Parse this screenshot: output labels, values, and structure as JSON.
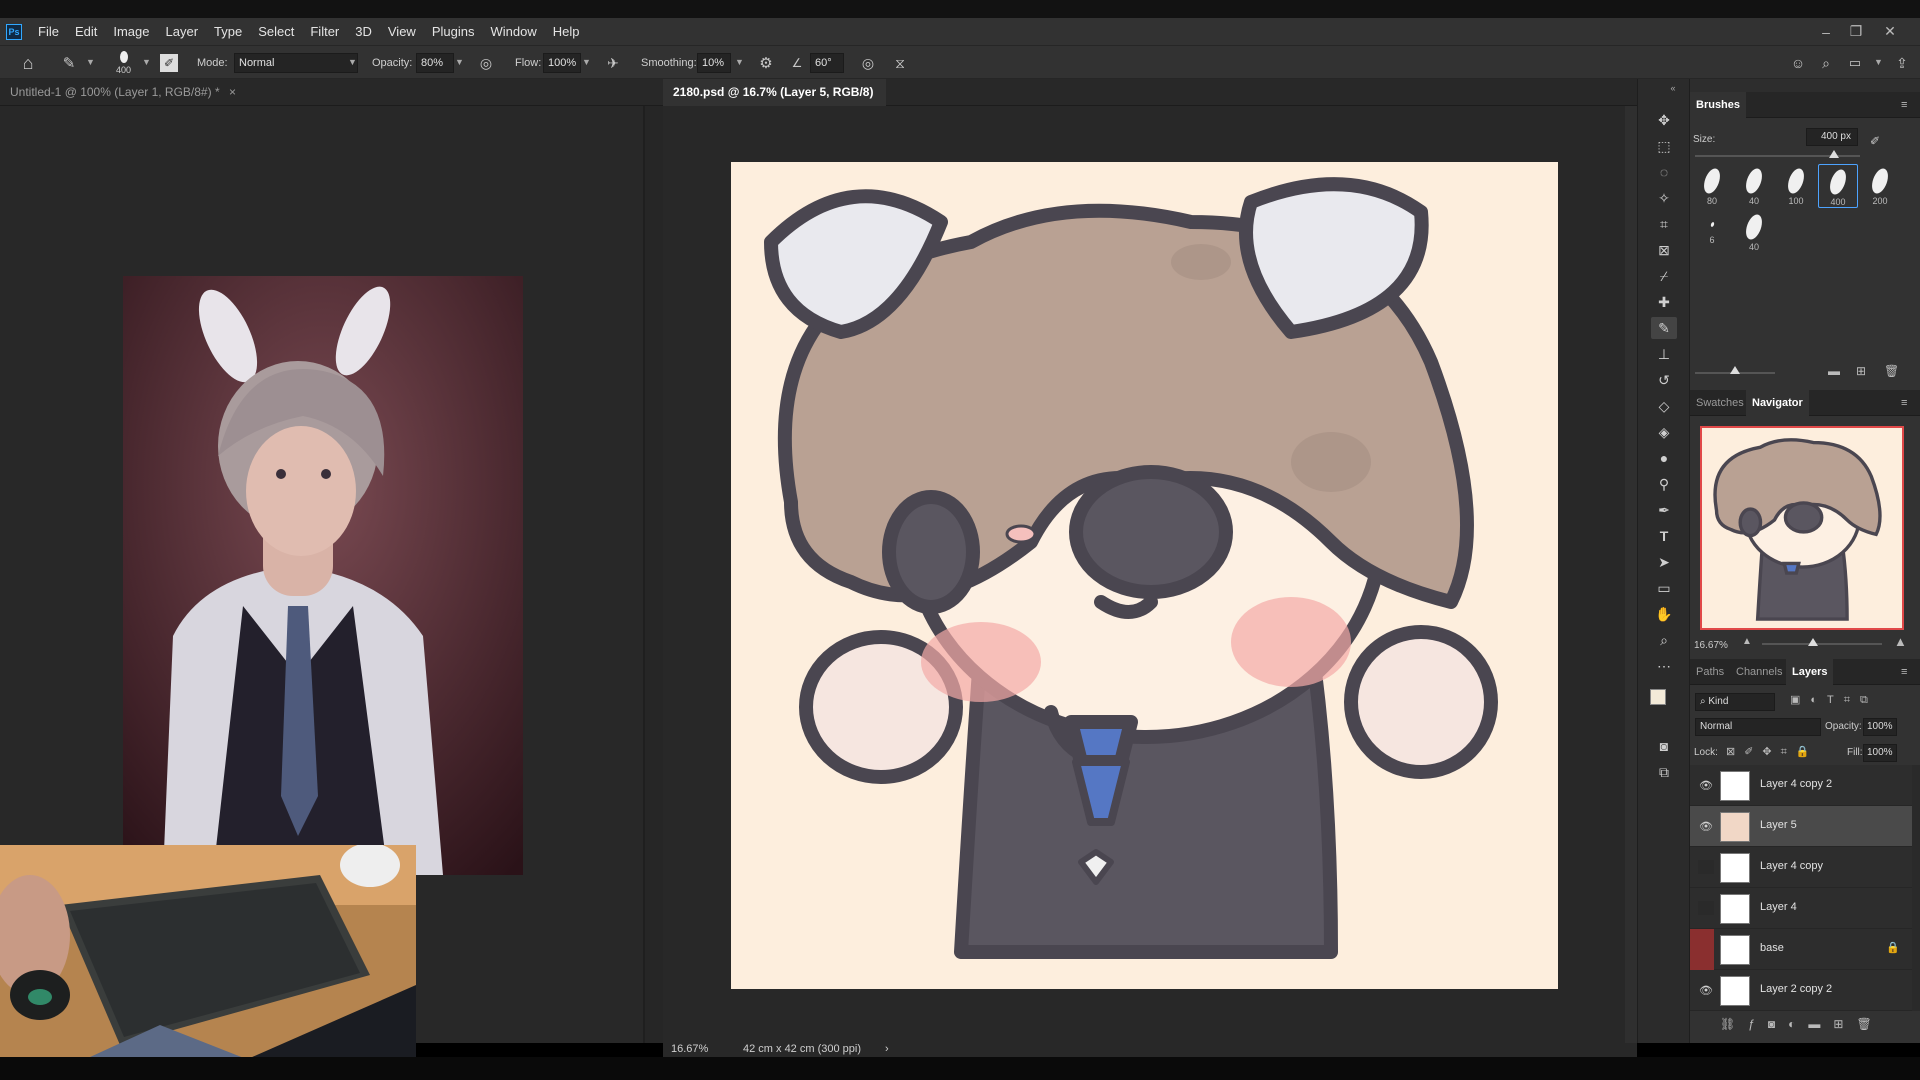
{
  "app": {
    "logo": "Ps"
  },
  "menu": [
    "File",
    "Edit",
    "Image",
    "Layer",
    "Type",
    "Select",
    "Filter",
    "3D",
    "View",
    "Plugins",
    "Window",
    "Help"
  ],
  "options": {
    "brush_size": "400",
    "mode_label": "Mode:",
    "mode_value": "Normal",
    "opacity_label": "Opacity:",
    "opacity_value": "80%",
    "flow_label": "Flow:",
    "flow_value": "100%",
    "smoothing_label": "Smoothing:",
    "smoothing_value": "10%",
    "angle_value": "60°"
  },
  "tabs": [
    {
      "label": "Untitled-1 @ 100% (Layer 1, RGB/8#) *",
      "close": "×"
    },
    {
      "label": "2180.psd @ 16.7% (Layer 5, RGB/8) *",
      "close": "×"
    }
  ],
  "status": {
    "zoom": "16.67%",
    "doc_size": "42 cm x 42 cm (300 ppi)",
    "arrow": "›"
  },
  "brushes": {
    "title": "Brushes",
    "size_label": "Size:",
    "size_value": "400 px",
    "tips": [
      "80",
      "40",
      "100",
      "400",
      "200",
      "6",
      "40"
    ]
  },
  "navigator": {
    "tabs": [
      "Swatches",
      "Navigator"
    ],
    "zoom": "16.67%"
  },
  "layers_panel": {
    "tabs": [
      "Paths",
      "Channels",
      "Layers"
    ],
    "filter": "Kind",
    "blend": "Normal",
    "opacity_label": "Opacity:",
    "opacity_value": "100%",
    "lock_label": "Lock:",
    "fill_label": "Fill:",
    "fill_value": "100%",
    "layers": [
      {
        "name": "Layer 4 copy 2",
        "visible": true
      },
      {
        "name": "Layer 5",
        "visible": true
      },
      {
        "name": "Layer 4 copy",
        "visible": false
      },
      {
        "name": "Layer 4",
        "visible": false
      },
      {
        "name": "base",
        "visible": false
      },
      {
        "name": "Layer 2 copy 2",
        "visible": true
      }
    ]
  },
  "colors": {
    "accent": "#31a8ff",
    "canvas_bg": "#fdeedd",
    "hair": "#b9a193",
    "outline": "#4a4650",
    "tie": "#5577c4",
    "blush": "#f4aaa7",
    "ref_bg": "#3a1e24"
  }
}
